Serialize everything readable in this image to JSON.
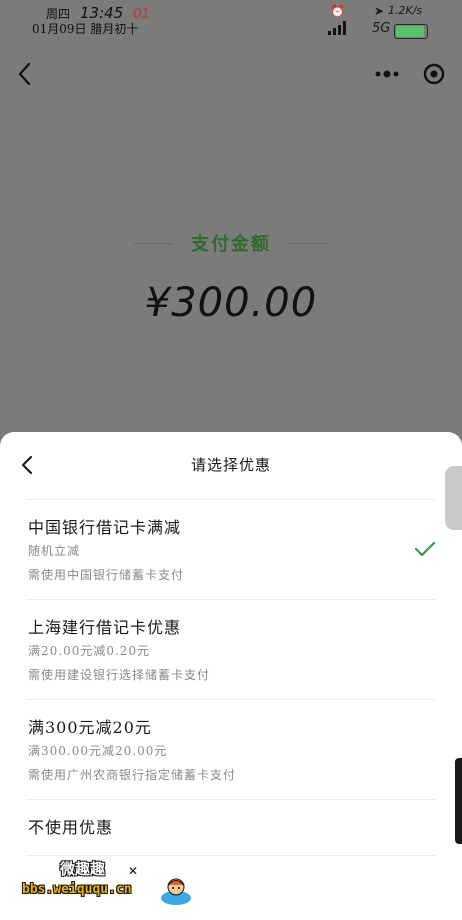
{
  "status_bar": {
    "weekday": "周四",
    "time": "13:45",
    "seconds": "01",
    "date": "01月09日",
    "lunar_date": "腊月初十",
    "net_speed": "1.2K/s",
    "network": "5G",
    "battery_color": "#58c36a"
  },
  "nav": {
    "back_icon": "chevron-left-icon",
    "more_icon": "more-dots-icon",
    "close_icon": "target-close-icon"
  },
  "payment": {
    "label": "支付金额",
    "amount": "¥300.00",
    "label_color": "#2e6a2a"
  },
  "sheet": {
    "title": "请选择优惠",
    "check_color": "#3a9a4a",
    "options": [
      {
        "title": "中国银行借记卡满减",
        "line1": "随机立减",
        "line2": "需使用中国银行储蓄卡支付",
        "selected": true
      },
      {
        "title": "上海建行借记卡优惠",
        "line1": "满20.00元减0.20元",
        "line2": "需使用建设银行选择储蓄卡支付",
        "selected": false
      },
      {
        "title": "满300元减20元",
        "line1": "满300.00元减20.00元",
        "line2": "需使用广州农商银行指定储蓄卡支付",
        "selected": false
      },
      {
        "title": "不使用优惠",
        "selected": false
      }
    ]
  },
  "watermark": {
    "brand": "微趣趣",
    "url": "bbs.weiququ.cn"
  }
}
